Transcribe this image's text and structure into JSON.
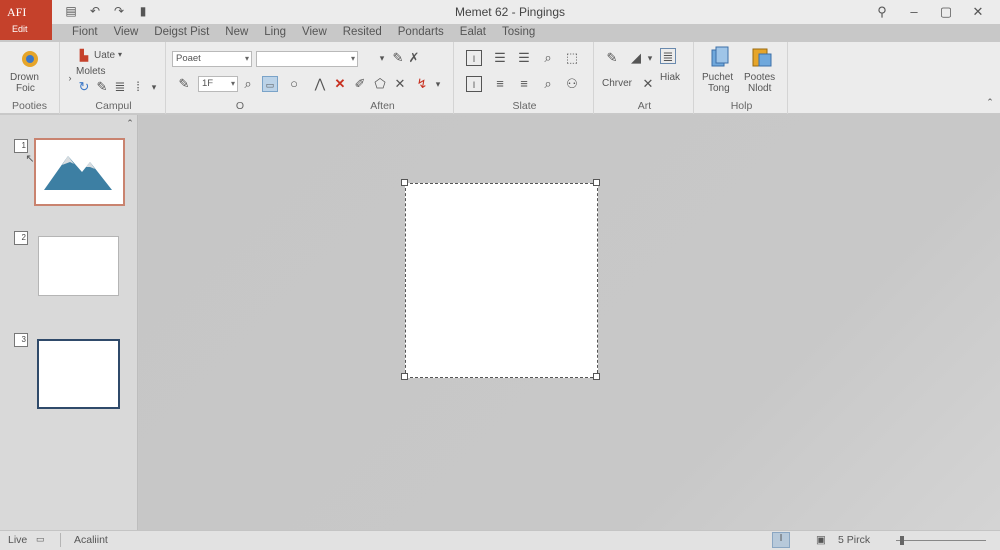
{
  "app": {
    "badge_line1": "AFI",
    "badge_line2": "Edit",
    "title": "Memet 62 - Pingings"
  },
  "quick_access": [
    "save-icon",
    "undo-icon",
    "redo-icon",
    "customize-icon"
  ],
  "window_controls": [
    "pin-icon",
    "minimize-icon",
    "restore-icon",
    "close-icon"
  ],
  "tabs": [
    "Fiont",
    "View",
    "Deigst Pist",
    "New",
    "Ling",
    "View",
    "Resited",
    "Pondarts",
    "Ealat",
    "Tosing"
  ],
  "ribbon": {
    "clipboard": {
      "label": "Pooties",
      "big_button_line1": "Drown",
      "big_button_line2": "Foic"
    },
    "compul": {
      "label": "Campul",
      "item1": "Uate",
      "item2": "Molets"
    },
    "font": {
      "label": "O",
      "font_name": "Poaet",
      "font_size": "1F"
    },
    "after": {
      "label": "Aften"
    },
    "slate": {
      "label": "Slate"
    },
    "art": {
      "label": "Art",
      "item1": "Chrver",
      "item2": "Hiak"
    },
    "help": {
      "label": "Holp",
      "item1_line1": "Puchet",
      "item1_line2": "Tong",
      "item2_line1": "Pootes",
      "item2_line2": "Nlodt"
    }
  },
  "slides": [
    {
      "number": "1",
      "selected": true
    },
    {
      "number": "2",
      "selected": false
    },
    {
      "number": "3",
      "selected": false
    }
  ],
  "status": {
    "left": "Live",
    "middle": "Acaliint",
    "zoom_text": "5 Pirck"
  },
  "colors": {
    "accent": "#c5412b",
    "mountain": "#3d7fa3",
    "snow": "#d9dde0"
  }
}
